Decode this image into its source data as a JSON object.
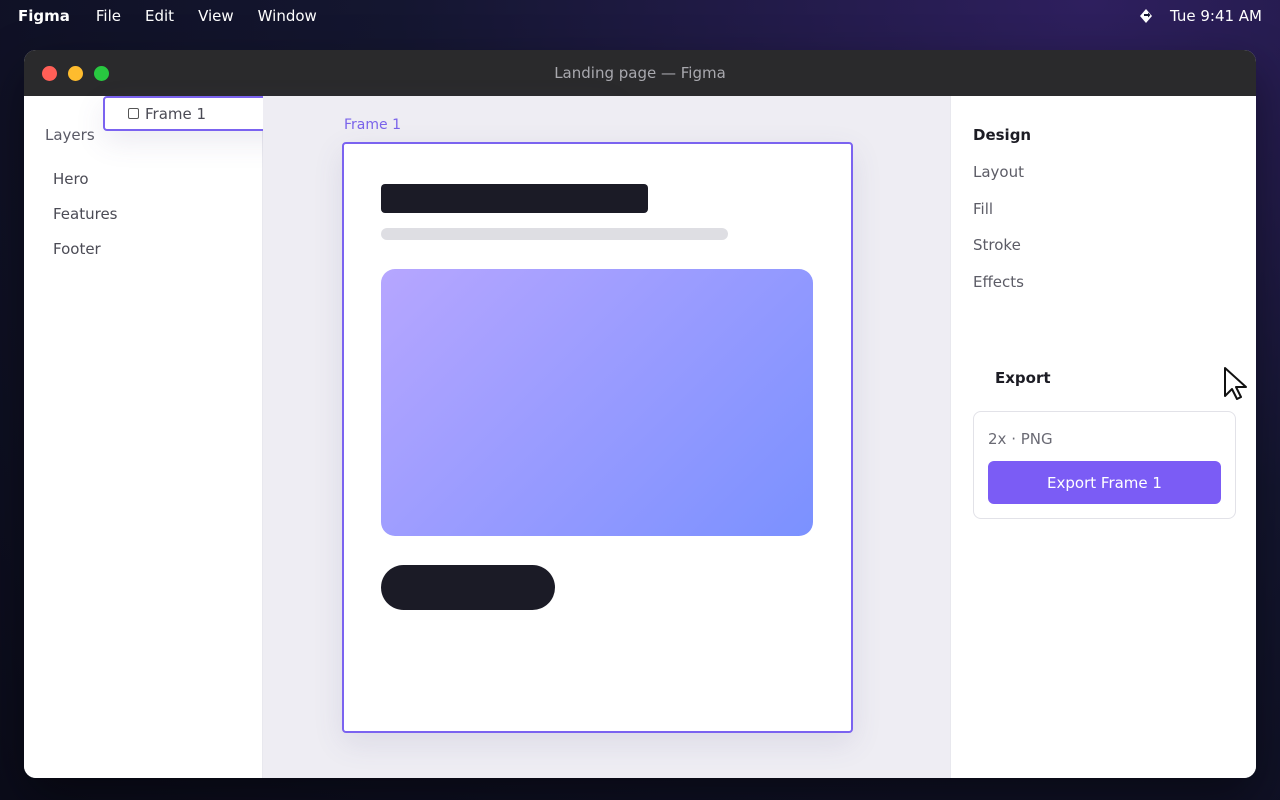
{
  "menubar": {
    "app_name": "Figma",
    "items": [
      "File",
      "Edit",
      "View",
      "Window"
    ],
    "clock": "Tue 9:41 AM",
    "status_icon": "sync-icon"
  },
  "window": {
    "title": "Landing page — Figma"
  },
  "layers": {
    "title": "Layers",
    "items": [
      {
        "label": "Frame 1",
        "kind": "frame"
      },
      {
        "label": "Hero",
        "kind": "child"
      },
      {
        "label": "Features",
        "kind": "child"
      },
      {
        "label": "Footer",
        "kind": "child"
      }
    ]
  },
  "canvas": {
    "frame_label": "Frame 1"
  },
  "design": {
    "title": "Design",
    "properties": [
      "Layout",
      "Fill",
      "Stroke",
      "Effects"
    ],
    "export": {
      "title": "Export",
      "settings": "2x · PNG",
      "button_label": "Export Frame 1"
    }
  },
  "colors": {
    "accent": "#7b5cf5",
    "frame_outline": "#7b63f0",
    "canvas_bg": "#eeedf3",
    "gradient_start": "#b6a6ff",
    "gradient_end": "#7b91ff"
  }
}
